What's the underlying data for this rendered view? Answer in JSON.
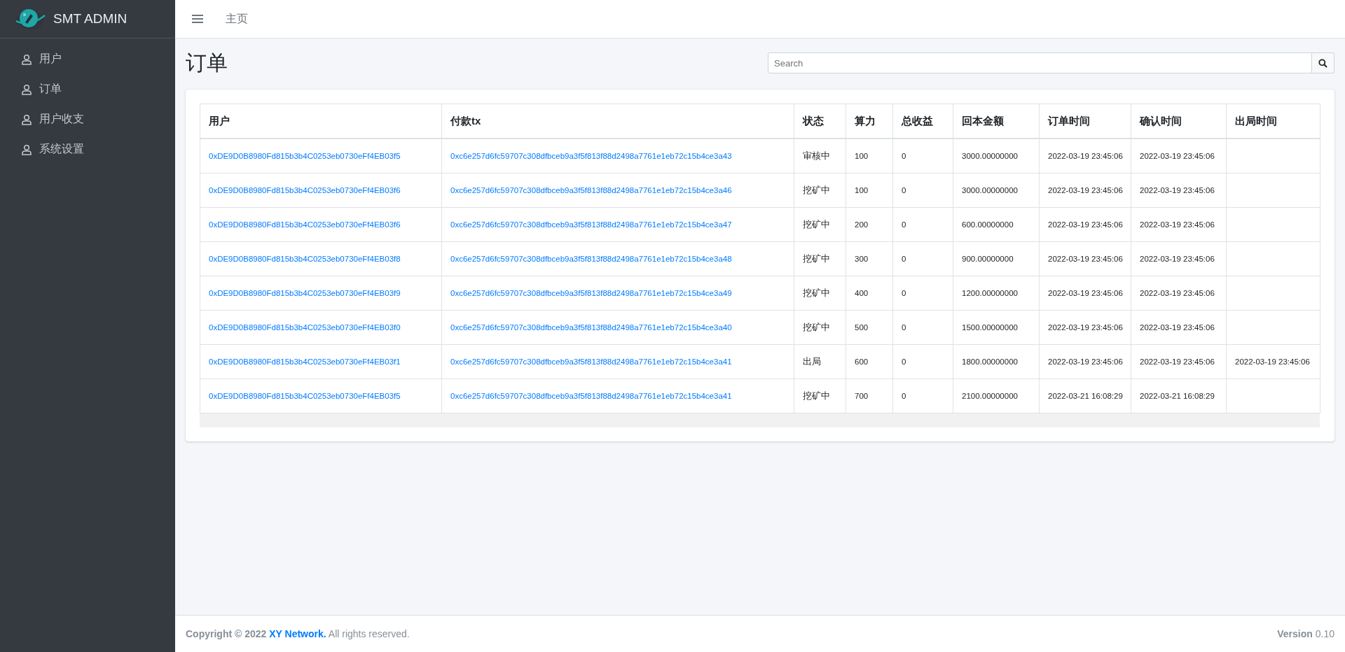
{
  "brand": {
    "name": "SMT ADMIN"
  },
  "sidebar": {
    "items": [
      {
        "label": "用户"
      },
      {
        "label": "订单"
      },
      {
        "label": "用户收支"
      },
      {
        "label": "系统设置"
      }
    ]
  },
  "topbar": {
    "breadcrumb": "主页"
  },
  "page": {
    "title": "订单",
    "search": {
      "placeholder": "Search"
    }
  },
  "table": {
    "columns": [
      "用户",
      "付款tx",
      "状态",
      "算力",
      "总收益",
      "回本金额",
      "订单时间",
      "确认时间",
      "出局时间"
    ],
    "rows": [
      [
        "0xDE9D0B8980Fd815b3b4C0253eb0730eFf4EB03f5",
        "0xc6e257d6fc59707c308dfbceb9a3f5f813f88d2498a7761e1eb72c15b4ce3a43",
        "审核中",
        "100",
        "0",
        "3000.00000000",
        "2022-03-19 23:45:06",
        "2022-03-19 23:45:06",
        ""
      ],
      [
        "0xDE9D0B8980Fd815b3b4C0253eb0730eFf4EB03f6",
        "0xc6e257d6fc59707c308dfbceb9a3f5f813f88d2498a7761e1eb72c15b4ce3a46",
        "挖矿中",
        "100",
        "0",
        "3000.00000000",
        "2022-03-19 23:45:06",
        "2022-03-19 23:45:06",
        ""
      ],
      [
        "0xDE9D0B8980Fd815b3b4C0253eb0730eFf4EB03f6",
        "0xc6e257d6fc59707c308dfbceb9a3f5f813f88d2498a7761e1eb72c15b4ce3a47",
        "挖矿中",
        "200",
        "0",
        "600.00000000",
        "2022-03-19 23:45:06",
        "2022-03-19 23:45:06",
        ""
      ],
      [
        "0xDE9D0B8980Fd815b3b4C0253eb0730eFf4EB03f8",
        "0xc6e257d6fc59707c308dfbceb9a3f5f813f88d2498a7761e1eb72c15b4ce3a48",
        "挖矿中",
        "300",
        "0",
        "900.00000000",
        "2022-03-19 23:45:06",
        "2022-03-19 23:45:06",
        ""
      ],
      [
        "0xDE9D0B8980Fd815b3b4C0253eb0730eFf4EB03f9",
        "0xc6e257d6fc59707c308dfbceb9a3f5f813f88d2498a7761e1eb72c15b4ce3a49",
        "挖矿中",
        "400",
        "0",
        "1200.00000000",
        "2022-03-19 23:45:06",
        "2022-03-19 23:45:06",
        ""
      ],
      [
        "0xDE9D0B8980Fd815b3b4C0253eb0730eFf4EB03f0",
        "0xc6e257d6fc59707c308dfbceb9a3f5f813f88d2498a7761e1eb72c15b4ce3a40",
        "挖矿中",
        "500",
        "0",
        "1500.00000000",
        "2022-03-19 23:45:06",
        "2022-03-19 23:45:06",
        ""
      ],
      [
        "0xDE9D0B8980Fd815b3b4C0253eb0730eFf4EB03f1",
        "0xc6e257d6fc59707c308dfbceb9a3f5f813f88d2498a7761e1eb72c15b4ce3a41",
        "出局",
        "600",
        "0",
        "1800.00000000",
        "2022-03-19 23:45:06",
        "2022-03-19 23:45:06",
        "2022-03-19 23:45:06"
      ],
      [
        "0xDE9D0B8980Fd815b3b4C0253eb0730eFf4EB03f5",
        "0xc6e257d6fc59707c308dfbceb9a3f5f813f88d2498a7761e1eb72c15b4ce3a41",
        "挖矿中",
        "700",
        "0",
        "2100.00000000",
        "2022-03-21 16:08:29",
        "2022-03-21 16:08:29",
        ""
      ]
    ]
  },
  "footer": {
    "copyright": "**Copyright © 2022** ",
    "company": "XY Network.",
    "rights": " All rights reserved.",
    "version_label": "Version",
    "version": "0.10"
  }
}
